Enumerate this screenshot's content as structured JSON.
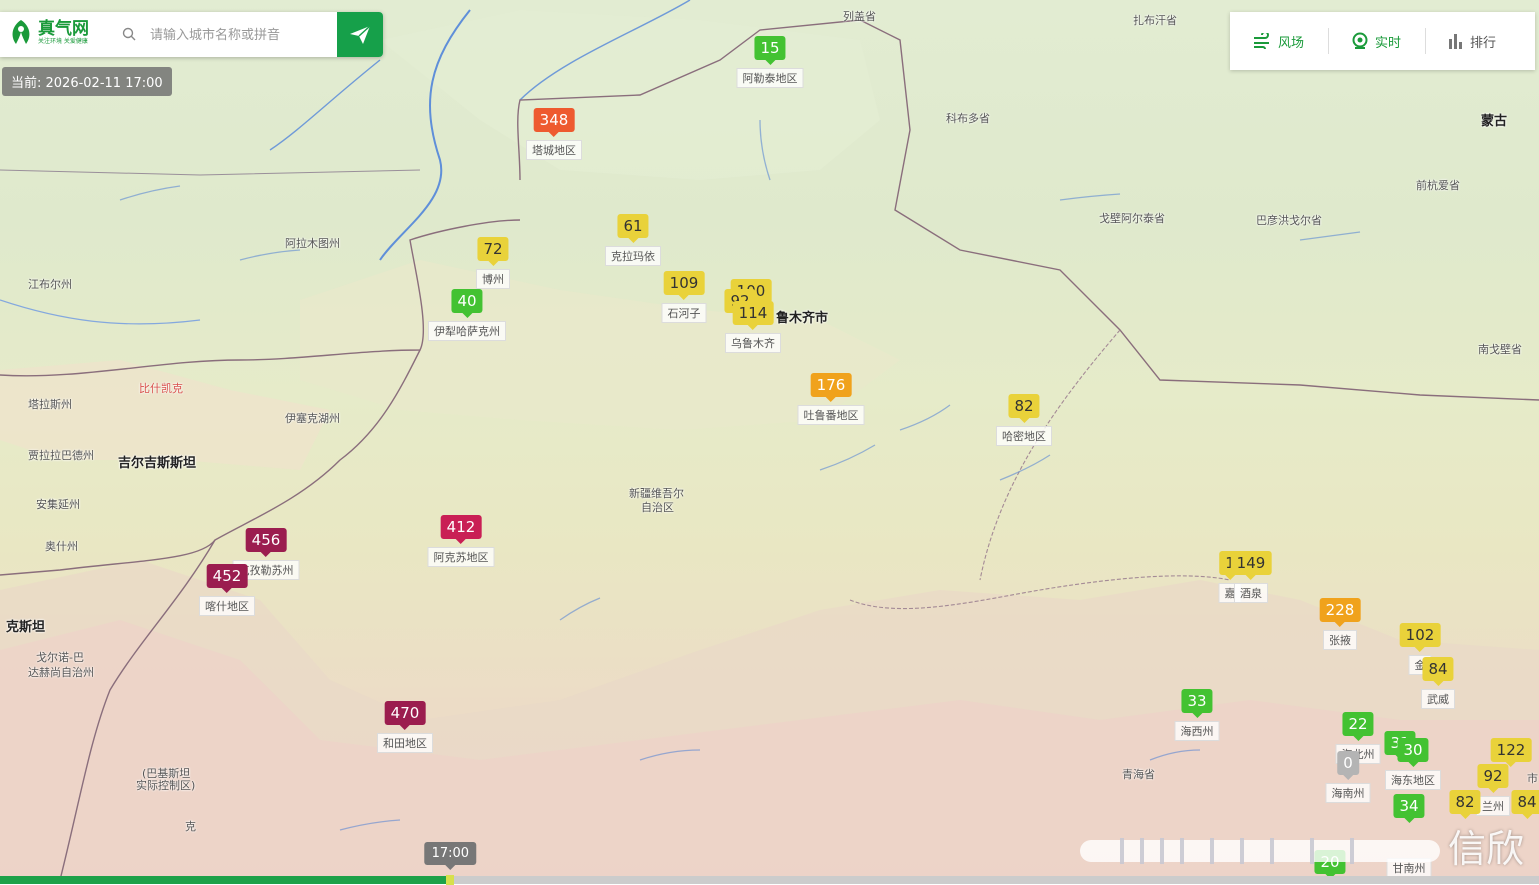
{
  "app": {
    "logo_title": "真气网",
    "logo_slogan": "关注环境 关爱健康",
    "search_placeholder": "请输入城市名称或拼音",
    "current_time": "当前: 2026-02-11 17:00"
  },
  "toolbar": [
    {
      "label": "风场",
      "icon": "wind-icon"
    },
    {
      "label": "实时",
      "icon": "realtime-pin-icon"
    },
    {
      "label": "排行",
      "icon": "ranking-bars-icon"
    }
  ],
  "timeline": {
    "bubble": "17:00",
    "progress": 0.29
  },
  "watermark": "信欣",
  "aqi_colors": {
    "excellent": "#43c232",
    "good": "#e9d23a",
    "light": "#f0a21c",
    "moderate": "#ee5a2f",
    "heavy": "#c91f55",
    "severe": "#9b1d4f",
    "nodata": "#b4b4b4"
  },
  "places": [
    {
      "name": "列盖省",
      "style": "normal"
    },
    {
      "name": "扎布汗省",
      "style": "normal"
    },
    {
      "name": "科布多省",
      "style": "normal"
    },
    {
      "name": "蒙古",
      "style": "big"
    },
    {
      "name": "前杭爱省",
      "style": "normal"
    },
    {
      "name": "戈壁阿尔泰省",
      "style": "normal"
    },
    {
      "name": "巴彦洪戈尔省",
      "style": "normal"
    },
    {
      "name": "南戈壁省",
      "style": "normal"
    },
    {
      "name": "阿拉木图州",
      "style": "normal"
    },
    {
      "name": "江布尔州",
      "style": "normal"
    },
    {
      "name": "比什凯克",
      "style": "red"
    },
    {
      "name": "塔拉斯州",
      "style": "normal"
    },
    {
      "name": "伊塞克湖州",
      "style": "normal"
    },
    {
      "name": "贾拉拉巴德州",
      "style": "normal"
    },
    {
      "name": "吉尔吉斯斯坦",
      "style": "big"
    },
    {
      "name": "安集延州",
      "style": "normal"
    },
    {
      "name": "奥什州",
      "style": "normal"
    },
    {
      "name": "克斯坦",
      "style": "big"
    },
    {
      "name": "戈尔诺-巴",
      "style": "normal"
    },
    {
      "name": "达赫尚自治州",
      "style": "normal"
    },
    {
      "name": "(巴基斯坦",
      "style": "normal"
    },
    {
      "name": "实际控制区)",
      "style": "normal"
    },
    {
      "name": "克",
      "style": "normal"
    },
    {
      "name": "新疆维吾尔",
      "style": "normal"
    },
    {
      "name": "自治区",
      "style": "normal"
    },
    {
      "name": "鲁木齐市",
      "style": "big"
    },
    {
      "name": "青海省",
      "style": "normal"
    },
    {
      "name": "市",
      "style": "normal"
    }
  ],
  "stations": [
    {
      "aqi": "15",
      "city": "阿勒泰地区",
      "level": "excellent"
    },
    {
      "aqi": "348",
      "city": "塔城地区",
      "level": "moderate"
    },
    {
      "aqi": "61",
      "city": "克拉玛依",
      "level": "good"
    },
    {
      "aqi": "72",
      "city": "博州",
      "level": "good"
    },
    {
      "aqi": "40",
      "city": "伊犁哈萨克州",
      "level": "excellent"
    },
    {
      "aqi": "109",
      "city": "石河子",
      "level": "good"
    },
    {
      "aqi": "100",
      "city": "",
      "level": "good"
    },
    {
      "aqi": "92",
      "city": "",
      "level": "good"
    },
    {
      "aqi": "114",
      "city": "乌鲁木齐",
      "level": "good"
    },
    {
      "aqi": "176",
      "city": "吐鲁番地区",
      "level": "light"
    },
    {
      "aqi": "82",
      "city": "哈密地区",
      "level": "good"
    },
    {
      "aqi": "412",
      "city": "阿克苏地区",
      "level": "heavy"
    },
    {
      "aqi": "456",
      "city": "克孜勒苏州",
      "level": "severe"
    },
    {
      "aqi": "452",
      "city": "喀什地区",
      "level": "severe"
    },
    {
      "aqi": "470",
      "city": "和田地区",
      "level": "severe"
    },
    {
      "aqi": "1",
      "city": "嘉",
      "level": "good"
    },
    {
      "aqi": "149",
      "city": "酒泉",
      "level": "good"
    },
    {
      "aqi": "228",
      "city": "张掖",
      "level": "light"
    },
    {
      "aqi": "102",
      "city": "金",
      "level": "good"
    },
    {
      "aqi": "84",
      "city": "武威",
      "level": "good"
    },
    {
      "aqi": "33",
      "city": "海西州",
      "level": "excellent"
    },
    {
      "aqi": "22",
      "city": "海北州",
      "level": "excellent"
    },
    {
      "aqi": "0",
      "city": "海南州",
      "level": "nodata"
    },
    {
      "aqi": "31",
      "city": "",
      "level": "excellent"
    },
    {
      "aqi": "30",
      "city": "海东地区",
      "level": "excellent"
    },
    {
      "aqi": "122",
      "city": "",
      "level": "good"
    },
    {
      "aqi": "92",
      "city": "兰州",
      "level": "good"
    },
    {
      "aqi": "82",
      "city": "",
      "level": "good"
    },
    {
      "aqi": "84",
      "city": "",
      "level": "good"
    },
    {
      "aqi": "34",
      "city": "甘南州",
      "level": "excellent"
    },
    {
      "aqi": "20",
      "city": "",
      "level": "excellent"
    }
  ]
}
